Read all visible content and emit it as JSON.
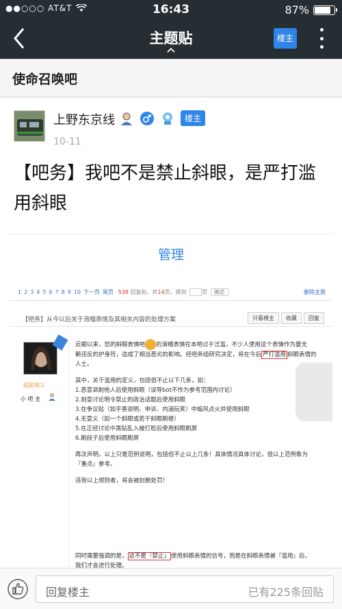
{
  "status_bar": {
    "carrier": "●●○○○ AT&T",
    "time": "16:43",
    "battery_text": "87%",
    "battery_level": 0.87
  },
  "nav": {
    "title": "主题贴",
    "owner_button": "楼主"
  },
  "forum": {
    "name": "使命召唤吧"
  },
  "post": {
    "username": "上野东京线",
    "owner_tag": "楼主",
    "date": "10-11",
    "title": "【吧务】我吧不是禁止斜眼，是严打滥用斜眼",
    "manage_link": "管理"
  },
  "screenshot": {
    "pager": {
      "pages": [
        "1",
        "2",
        "3",
        "4",
        "5",
        "6",
        "7",
        "8",
        "9",
        "10",
        "下一页",
        "尾页"
      ],
      "reply_count": "538",
      "reply_label": "回复贴，共",
      "page_count": "14",
      "page_label": "页，跳到",
      "page_unit": "页",
      "confirm": "确定",
      "delete_topic": "删除主题"
    },
    "topic_title": "【吧务】从今以后关于滑稽表情及其相关内容的处理方案",
    "buttons": [
      "只看楼主",
      "收藏",
      "回复"
    ],
    "op_name": "超影咲三",
    "op_role": "小 吧 主",
    "paragraph1_a": "近期以来，您的斜眼表情吧",
    "paragraph1_b": "的滑稽表情在本吧过于泛滥，不少人使用这个表情作为要无",
    "paragraph1_c": "赖违反的护身符，造成了相当恶劣的影响。经吧务组研究决定，将在今后",
    "paragraph1_boxed": "严打滥用",
    "paragraph1_d": "斜眼表情的",
    "paragraph1_e": "人士。",
    "list_intro": "其中，关于滥用的定义，包括但不止以下几条，如：",
    "list": [
      "1.恶意讽刺他人后使用斜眼（误导bot不作为参考范围内讨论）",
      "2.刻意讨论明令禁止的政治话题后使用斜眼",
      "3.在争议贴（如乎喜说明、申诉、内涵玩笑）中煽风点火并使用斜眼",
      "4.无意义（如一个斜眼或若干斜眼刷楼）",
      "5.在正经讨论中黑贴乱入被打脸后使用斜眼刷屏",
      "6.刷段子后使用斜眼刷屏"
    ],
    "paragraph2": "再次声明，以上只是范例说明，包括但不止以上几条！具体情况具体讨论，但以上范例象为『重点』参考。",
    "paragraph3": "违背以上规则者，将会被封删处罚！",
    "last_a": "同时需要强调的是，",
    "last_boxed1": "这不是『禁止』",
    "last_b": "使用斜眼表情的信号，而是在斜眼表情被『滥用』后，",
    "last_c": "我们才会进行处理。"
  },
  "reply_bar": {
    "placeholder": "回复楼主",
    "count": "已有225条回贴"
  }
}
